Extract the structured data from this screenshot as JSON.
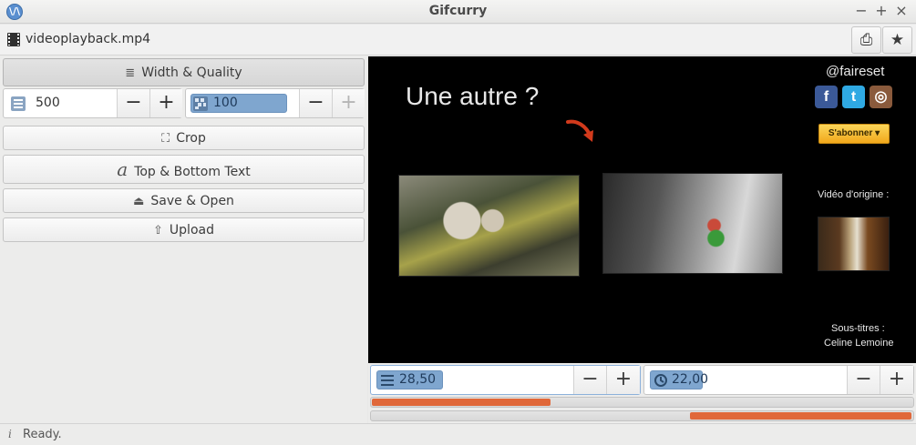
{
  "window": {
    "title": "Gifcurry",
    "minimize": "−",
    "maximize": "+",
    "close": "×"
  },
  "file": {
    "name": "videoplayback.mp4"
  },
  "toolbar": {
    "open_icon": "⎙",
    "star_icon": "★"
  },
  "sidebar": {
    "width_quality": {
      "label": "Width & Quality",
      "icon": "≣"
    },
    "width_value": "500",
    "quality_value": "100",
    "minus": "−",
    "plus": "+",
    "crop": {
      "label": "Crop",
      "icon": "⛶"
    },
    "text": {
      "label": "Top & Bottom Text",
      "icon": "a"
    },
    "save": {
      "label": "Save & Open",
      "icon": "⏏"
    },
    "upload": {
      "label": "Upload",
      "icon": "⇧"
    }
  },
  "video": {
    "handle": "@faireset",
    "headline": "Une autre ?",
    "subscribe": "S'abonner ▾",
    "origin_label": "Vidéo d'origine :",
    "subtitles_label": "Sous-titres :",
    "subtitles_name": "Celine Lemoine",
    "social": [
      "f",
      "t",
      "◎"
    ]
  },
  "timeline": {
    "start_value": "28,50",
    "duration_value": "22,00",
    "start_progress": 0.33,
    "end_progress_from": 0.59
  },
  "status": {
    "icon": "i",
    "text": "Ready."
  }
}
